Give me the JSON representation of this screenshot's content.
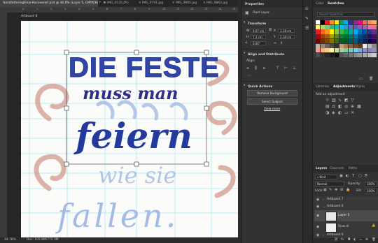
{
  "doc_tabs": [
    {
      "label": "HandletteringFinal-Recovered.psd @ 44.8% (Layer 5, CMYK/8) *",
      "active": true
    },
    {
      "label": "IMG_0126.JPG",
      "active": false
    },
    {
      "label": "IMG_9791.jpg",
      "active": false
    },
    {
      "label": "IMG_9905.jpg",
      "active": false
    },
    {
      "label": "IMG_9863.jpg",
      "active": false
    }
  ],
  "ruler_numbers": [
    "0",
    "1",
    "2",
    "3",
    "4",
    "5",
    "6",
    "7",
    "8",
    "9",
    "10",
    "11",
    "12",
    "13",
    "14",
    "15"
  ],
  "artboard_label": "Artboard 8",
  "lettering": {
    "line1": "DIE FESTE",
    "line2": "muss man",
    "line3": "feiern",
    "line4": "wie sie",
    "line5": "fallen."
  },
  "status": {
    "zoom": "44.78%",
    "doc": "Doc: 105.8M/772.3M"
  },
  "properties": {
    "title": "Properties",
    "layer_type": "Pixel Layer",
    "transform": {
      "title": "Transform",
      "w_label": "W",
      "w_value": "9.67 cm",
      "x_label": "X",
      "x_value": "3.18 cm",
      "h_label": "H",
      "h_value": "7.2 cm",
      "y_label": "Y",
      "y_value": "2.18 cm",
      "angle": "0.00°"
    },
    "align": {
      "title": "Align and Distribute",
      "subtitle": "Align:"
    },
    "quick_actions": {
      "title": "Quick Actions",
      "remove_bg": "Remove Background",
      "select_subject": "Select Subject",
      "view_more": "View more"
    }
  },
  "swatches": {
    "tabs": [
      "Color",
      "Swatches"
    ],
    "search_placeholder": "Search Swatches",
    "colors": [
      "#ffffff",
      "#000000",
      "#ed1c24",
      "#f7941d",
      "#fff200",
      "#00a651",
      "#00aeef",
      "#2e3192",
      "#92278f",
      "#ec008c",
      "#f26c4f",
      "#f68e56",
      "#fbaf5d",
      "#fff568",
      "#acd373",
      "#7cc576",
      "#3bb878",
      "#1abbb4",
      "#00bff3",
      "#438ccb",
      "#5574b9",
      "#605ca8",
      "#855fa8",
      "#a763a8",
      "#f06ea9",
      "#f26d7d",
      "#ed1c24",
      "#f26522",
      "#f7941d",
      "#fff200",
      "#8dc63f",
      "#39b54a",
      "#00a651",
      "#00a99d",
      "#00aeef",
      "#0072bc",
      "#0054a6",
      "#2e3192",
      "#662d91",
      "#9e0b0f",
      "#a0410d",
      "#a3620a",
      "#aba000",
      "#598527",
      "#197b30",
      "#007236",
      "#00746b",
      "#0076a3",
      "#004a80",
      "#003471",
      "#1b1464",
      "#440e62",
      "#790000",
      "#7b2e00",
      "#7d4900",
      "#827b00",
      "#406618",
      "#005e20",
      "#005826",
      "#005952",
      "#005b7f",
      "#003663",
      "#002157",
      "#0d004c",
      "#32004b",
      "#c7b299",
      "#998675",
      "#736357",
      "#534741",
      "#37302a",
      "#c69c6d",
      "#a67c52",
      "#8c6239",
      "#754c24",
      "#603913",
      "#ebebeb",
      "#b7b7b7",
      "#898989",
      "#f5989d",
      "#f9ad81",
      "#fdc68a",
      "#fff79a",
      "#c4df9b",
      "#a3d39c",
      "#82ca9c",
      "#7accc8",
      "#6dcff6",
      "#7da7d9",
      "#8393ca",
      "#8781bd",
      "#a186be",
      "#4d4d4d",
      "#333333",
      "#262626",
      "#1a1a1a",
      "#0d0d0d",
      "#555555",
      "#666666",
      "#777777",
      "#888888",
      "#999999",
      "#aaaaaa",
      "#bbbbbb",
      "#cccccc"
    ]
  },
  "adjustments": {
    "tabs": [
      "Libraries",
      "Adjustments",
      "Styles"
    ],
    "hint": "Add an adjustment"
  },
  "layers": {
    "tabs": [
      "Layers",
      "Channels",
      "Paths"
    ],
    "kind": "Kind",
    "blend": "Normal",
    "opacity_label": "Opacity:",
    "opacity": "100%",
    "lock_label": "Lock:",
    "fill_label": "Fill:",
    "fill": "100%",
    "rows": [
      {
        "name": "Artboard 7",
        "kind": "artboard"
      },
      {
        "name": "Artboard 8",
        "kind": "artboard"
      },
      {
        "name": "Layer 5",
        "kind": "layer"
      },
      {
        "name": "Scan 8",
        "kind": "layer"
      },
      {
        "name": "Artboard 9",
        "kind": "artboard"
      }
    ]
  },
  "colors": {
    "accent": "#1f2e8a",
    "ui_dark": "#323232",
    "ui_darker": "#262626",
    "selected": "#4b4b4b"
  }
}
